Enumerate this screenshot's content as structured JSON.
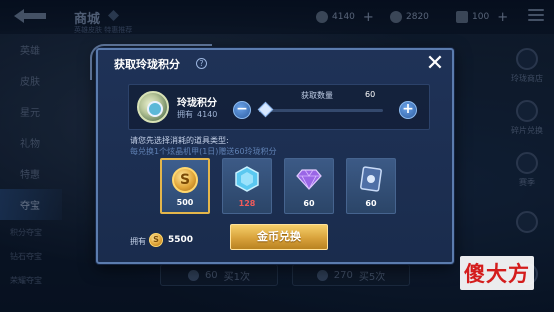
{
  "header": {
    "title": "商城",
    "subtitle": "英雄皮肤 特惠推荐",
    "currency": [
      {
        "icon": "coupon-icon",
        "value": "4140",
        "plus": "+"
      },
      {
        "icon": "gold-coin-icon",
        "value": "2820"
      },
      {
        "icon": "card-icon",
        "value": "100",
        "plus": "+"
      }
    ]
  },
  "left_nav": {
    "items": [
      "英雄",
      "皮肤",
      "星元",
      "礼物",
      "特惠",
      "夺宝"
    ],
    "sub_items": [
      "积分夺宝",
      "钻石夺宝",
      "荣耀夺宝"
    ],
    "selected": "夺宝"
  },
  "right_nav": {
    "items": [
      "玲珑商店",
      "碎片兑换",
      "赛季",
      "",
      ""
    ]
  },
  "bottom_buttons": [
    {
      "price": "60",
      "label": "买1次"
    },
    {
      "price": "270",
      "label": "买5次"
    }
  ],
  "dialog": {
    "title": "获取玲珑积分",
    "help": "?",
    "close": "✕",
    "points": {
      "name": "玲珑积分",
      "owned_label": "拥有",
      "owned_value": "4140"
    },
    "quantity": {
      "label": "获取数量",
      "value": "60",
      "fraction": 0.02,
      "minus": "−",
      "plus": "+"
    },
    "instruction": "请您先选择消耗的道具类型:",
    "hint": "每兑换1个炫晶机甲(1日)赠送60玲珑积分",
    "items": [
      {
        "icon": "gold-coin-icon",
        "cost": "500",
        "selected": true,
        "red": false
      },
      {
        "icon": "crystal-icon",
        "cost": "128",
        "selected": false,
        "red": true
      },
      {
        "icon": "gem-icon",
        "cost": "60",
        "selected": false,
        "red": false
      },
      {
        "icon": "card-icon",
        "cost": "60",
        "selected": false,
        "red": false
      }
    ],
    "own": {
      "label": "拥有",
      "coin": "S",
      "value": "5500"
    },
    "exchange_button": "金币兑换"
  },
  "watermark": "傻大方",
  "colors": {
    "dialog_bg": "#1f3257",
    "dialog_border": "#5b7cae",
    "gold": "#e4b64b",
    "hint_blue": "#5f80b3",
    "red": "#f05b5b"
  }
}
